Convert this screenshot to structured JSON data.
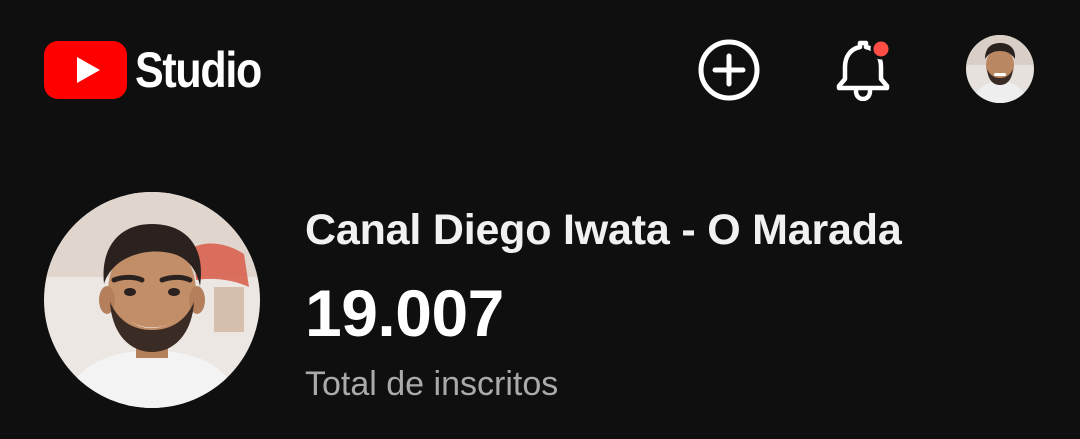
{
  "header": {
    "app_title": "Studio",
    "logo_icon": "youtube-play-icon",
    "brand_color": "#ff0000",
    "actions": [
      {
        "name": "create",
        "icon": "plus-circle-icon"
      },
      {
        "name": "notifications",
        "icon": "bell-icon",
        "has_unread_dot": true,
        "dot_color": "#ff4e45"
      },
      {
        "name": "account",
        "icon": "profile-photo"
      }
    ]
  },
  "channel": {
    "name": "Canal Diego Iwata - O Marada",
    "subscriber_count": "19.007",
    "subscriber_label": "Total de inscritos"
  }
}
